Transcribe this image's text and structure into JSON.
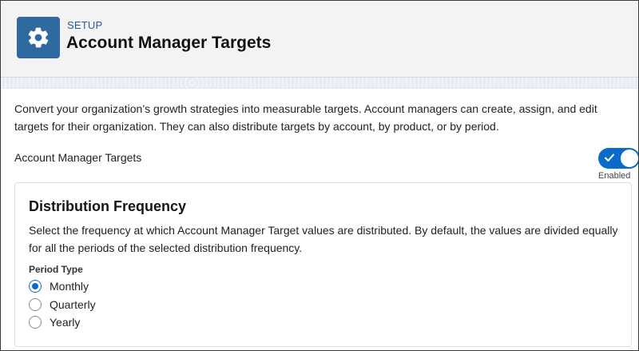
{
  "header": {
    "eyebrow": "SETUP",
    "title": "Account Manager Targets",
    "icon": "gear-icon",
    "icon_color": "#2e6aa1"
  },
  "intro": "Convert your organization’s growth strategies into measurable targets. Account managers can create, assign, and edit targets for their organization. They can also distribute targets by account, by product, or by period.",
  "feature": {
    "label": "Account Manager Targets",
    "toggle_on": true,
    "status": "Enabled",
    "accent": "#0b6bcb"
  },
  "distribution": {
    "title": "Distribution Frequency",
    "description": "Select the frequency at which Account Manager Target values are distributed. By default, the values are divided equally for all the periods of the selected distribution frequency.",
    "group_label": "Period Type",
    "options": [
      {
        "label": "Monthly",
        "selected": true
      },
      {
        "label": "Quarterly",
        "selected": false
      },
      {
        "label": "Yearly",
        "selected": false
      }
    ]
  }
}
